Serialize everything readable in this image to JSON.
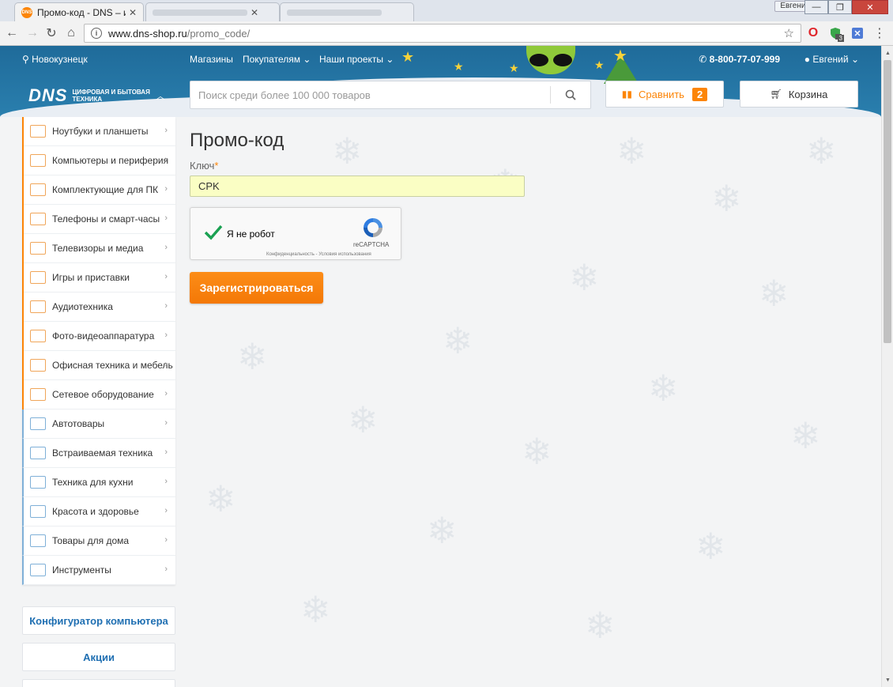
{
  "browser": {
    "active_tab_title": "Промо-код - DNS – инт",
    "active_tab_icon": "DNS",
    "profile_name": "Евгений",
    "url_host": "www.dns-shop.ru",
    "url_path": "/promo_code/",
    "extension_badge": "3"
  },
  "header": {
    "city": "Новокузнецк",
    "nav": [
      "Магазины",
      "Покупателям",
      "Наши проекты"
    ],
    "phone": "8-800-77-07-999",
    "user": "Евгений",
    "logo_main": "DNS",
    "logo_tagline": "Цифровая и бытовая техника",
    "search_placeholder": "Поиск среди более 100 000 товаров",
    "compare_label": "Сравнить",
    "compare_count": "2",
    "cart_label": "Корзина"
  },
  "sidebar": {
    "categories": [
      "Ноутбуки и планшеты",
      "Компьютеры и периферия",
      "Комплектующие для ПК",
      "Телефоны и смарт-часы",
      "Телевизоры и медиа",
      "Игры и приставки",
      "Аудиотехника",
      "Фото-видеоаппаратура",
      "Офисная техника и мебель",
      "Сетевое оборудование",
      "Автотовары",
      "Встраиваемая техника",
      "Техника для кухни",
      "Красота и здоровье",
      "Товары для дома",
      "Инструменты"
    ],
    "configurator": "Конфигуратор компьютера",
    "promo": "Акции"
  },
  "main": {
    "title": "Промо-код",
    "key_label": "Ключ",
    "key_required_mark": "*",
    "key_value": "CPK",
    "captcha_text": "Я не робот",
    "captcha_brand": "reCAPTCHA",
    "captcha_links": "Конфиденциальность - Условия использования",
    "submit_label": "Зарегистрироваться"
  },
  "colors": {
    "accent": "#fc8507",
    "header_blue": "#2a7fae",
    "link_blue": "#1f6fb2",
    "input_highlight": "#fafec4"
  }
}
